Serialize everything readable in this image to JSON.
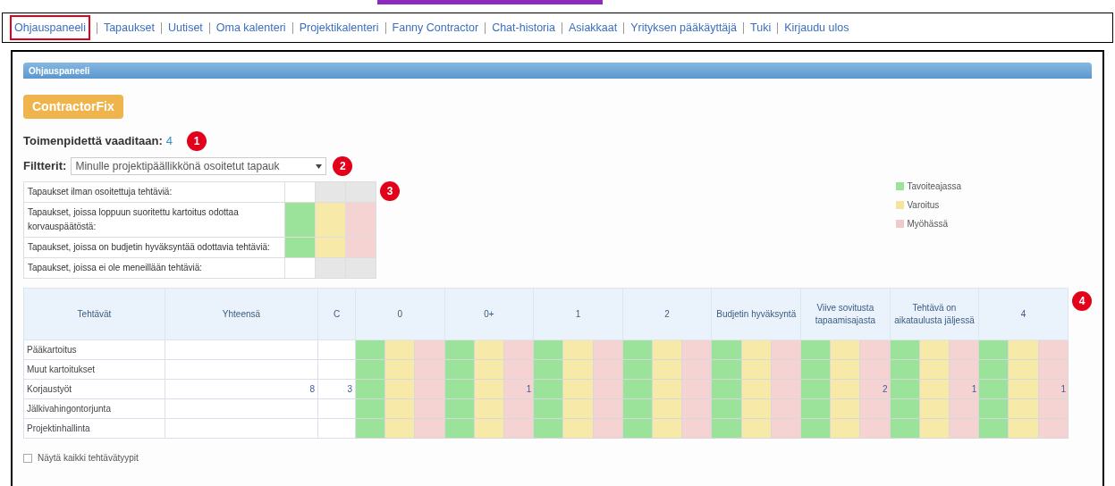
{
  "nav": [
    {
      "label": "Ohjauspaneeli",
      "selected": true
    },
    {
      "label": "Tapaukset",
      "selected": false
    },
    {
      "label": "Uutiset",
      "selected": false
    },
    {
      "label": "Oma kalenteri",
      "selected": false
    },
    {
      "label": "Projektikalenteri",
      "selected": false
    },
    {
      "label": "Fanny Contractor",
      "selected": false
    },
    {
      "label": "Chat-historia",
      "selected": false
    },
    {
      "label": "Asiakkaat",
      "selected": false
    },
    {
      "label": "Yrityksen pääkäyttäjä",
      "selected": false
    },
    {
      "label": "Tuki",
      "selected": false
    },
    {
      "label": "Kirjaudu ulos",
      "selected": false
    }
  ],
  "panel": {
    "title": "Ohjauspaneeli",
    "brand": "ContractorFix",
    "action_label": "Toimenpidettä vaaditaan:",
    "action_count": "4",
    "action_badge": "1",
    "filter_label": "Filtterit:",
    "filter_value": "Minulle projektipäällikkönä osoitetut tapauk",
    "filter_badge": "2",
    "summary_badge": "3",
    "summary": [
      {
        "label": "Tapaukset ilman osoitettuja tehtäviä:",
        "kind": "plain"
      },
      {
        "label": "Tapaukset, joissa loppuun suoritettu kartoitus odottaa korvauspäätöstä:",
        "kind": "status"
      },
      {
        "label": "Tapaukset, joissa on budjetin hyväksyntää odottavia tehtäviä:",
        "kind": "status"
      },
      {
        "label": "Tapaukset, joissa ei ole meneillään tehtäviä:",
        "kind": "plain"
      }
    ],
    "legend": [
      {
        "label": "Tavoiteajassa",
        "color": "#9be39b"
      },
      {
        "label": "Varoitus",
        "color": "#f5e59a"
      },
      {
        "label": "Myöhässä",
        "color": "#f2c9c9"
      }
    ],
    "table_badge": "4",
    "columns": [
      "Tehtävät",
      "Yhteensä",
      "C"
    ],
    "groups": [
      "0",
      "0+",
      "1",
      "2",
      "Budjetin hyväksyntä",
      "Viive sovitusta tapaamisajasta",
      "Tehtävä on aikataulusta jäljessä",
      "4"
    ],
    "rows": [
      {
        "name": "Pääkartoitus"
      },
      {
        "name": "Muut kartoitukset"
      },
      {
        "name": "Korjaustyöt",
        "total": "8",
        "c": "3",
        "late": [
          {
            "kind": "blank"
          },
          {
            "kind": "count",
            "value": "1"
          },
          {
            "kind": "blank"
          },
          {
            "kind": "blank"
          },
          {
            "kind": "blank"
          },
          {
            "kind": "count",
            "value": "2"
          },
          {
            "kind": "count",
            "value": "1"
          },
          {
            "kind": "count",
            "value": "1"
          }
        ]
      },
      {
        "name": "Jälkivahingontorjunta"
      },
      {
        "name": "Projektinhallinta"
      }
    ],
    "show_all": {
      "label": "Näytä kaikki tehtävätyypit",
      "checked": false
    }
  }
}
